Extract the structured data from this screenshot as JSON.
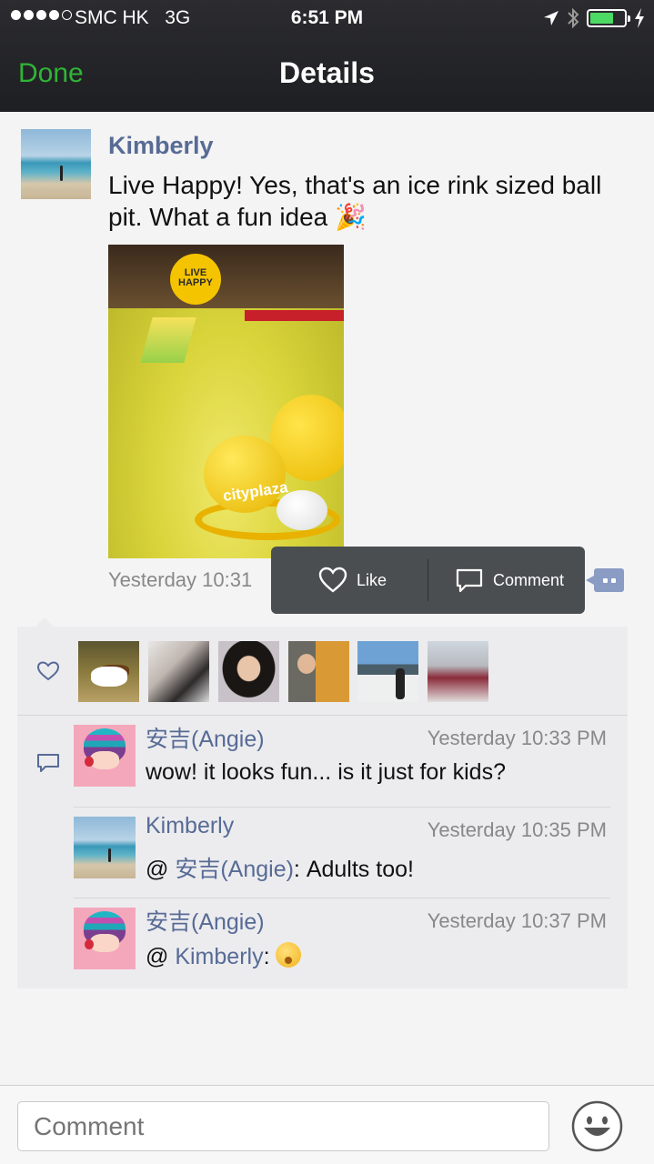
{
  "status_bar": {
    "carrier": "SMC HK",
    "network": "3G",
    "time": "6:51 PM",
    "signal_bars_filled": 4,
    "signal_bars_total": 5,
    "battery_level": 0.7,
    "colors": {
      "battery": "#4cd964"
    }
  },
  "nav": {
    "left_button": "Done",
    "title": "Details",
    "colors": {
      "done": "#2fb536",
      "bar_bg": "#1e1f22"
    }
  },
  "post": {
    "author": "Kimberly",
    "text": "Live Happy! Yes, that's an ice rink sized ball pit.  What a fun idea 🎉",
    "image_sign_text": "LIVE HAPPY",
    "image_ball_text": "cityplaza",
    "time": "Yesterday 10:31",
    "colors": {
      "name": "#576b95"
    }
  },
  "action_menu": {
    "like_label": "Like",
    "comment_label": "Comment"
  },
  "likes": {
    "icon": "heart-icon",
    "count_avatars": 6
  },
  "comments": [
    {
      "author": "安吉(Angie)",
      "time": "Yesterday 10:33 PM",
      "text": "wow! it looks fun... is it just for kids?"
    },
    {
      "author": "Kimberly",
      "time": "Yesterday 10:35 PM",
      "prefix": "@ ",
      "mention": "安吉(Angie)",
      "text": ": Adults too!"
    },
    {
      "author": "安吉(Angie)",
      "time": "Yesterday 10:37 PM",
      "prefix": "@ ",
      "mention": "Kimberly",
      "text": ": "
    }
  ],
  "comment_bar": {
    "placeholder": "Comment",
    "emoji_icon": "smiley-icon"
  }
}
